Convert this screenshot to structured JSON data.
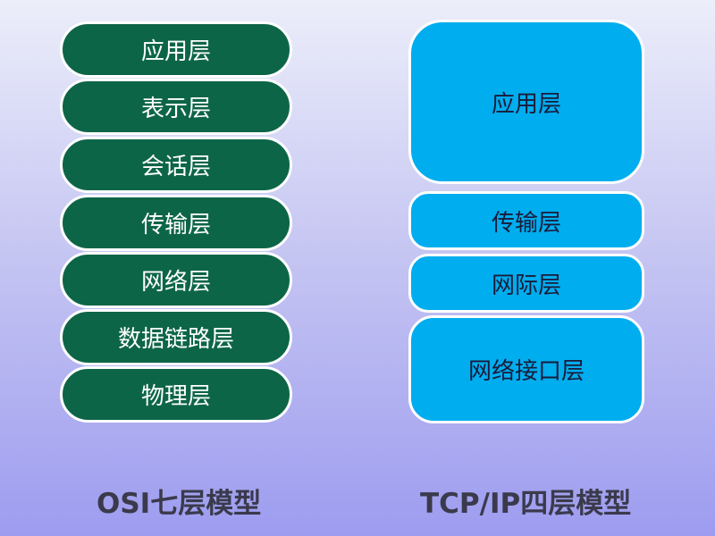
{
  "osi": {
    "layers": [
      "应用层",
      "表示层",
      "会话层",
      "传输层",
      "网络层",
      "数据链路层",
      "物理层"
    ],
    "caption": "OSI七层模型"
  },
  "tcpip": {
    "layers": [
      "应用层",
      "传输层",
      "网际层",
      "网络接口层"
    ],
    "caption": "TCP/IP四层模型"
  },
  "colors": {
    "osi_fill": "#0d6548",
    "tcp_fill": "#00adee",
    "border": "#ffffff"
  }
}
